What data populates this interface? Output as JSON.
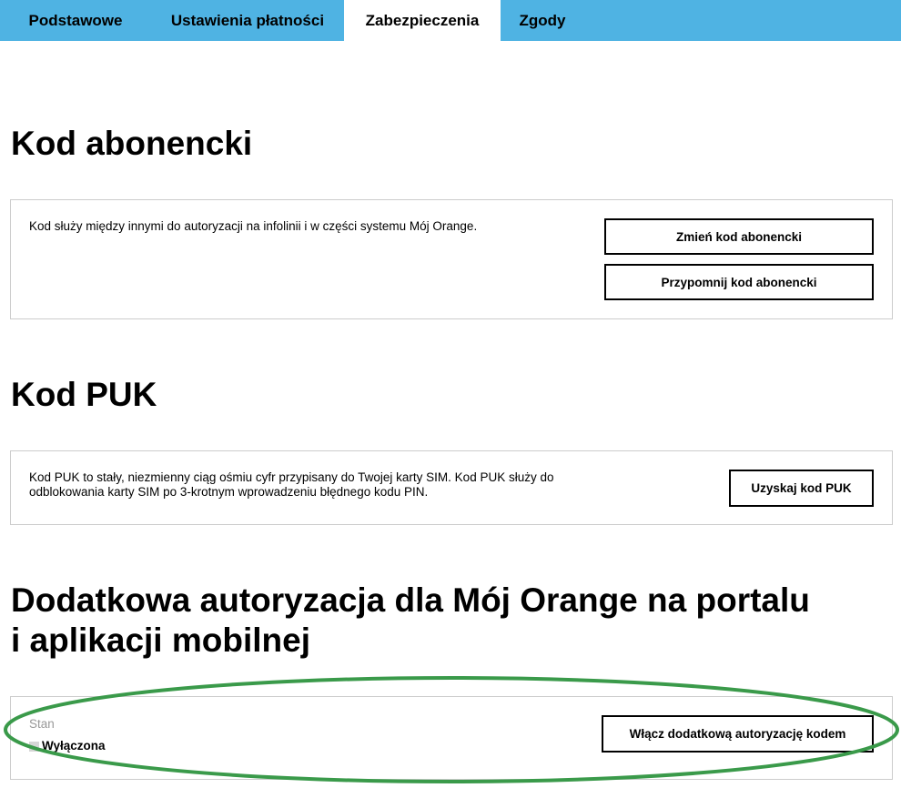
{
  "tabs": [
    {
      "label": "Podstawowe",
      "active": false
    },
    {
      "label": "Ustawienia płatności",
      "active": false
    },
    {
      "label": "Zabezpieczenia",
      "active": true
    },
    {
      "label": "Zgody",
      "active": false
    }
  ],
  "sections": {
    "subscriber_code": {
      "title": "Kod abonencki",
      "description": "Kod służy między innymi do autoryzacji na infolinii i w części systemu Mój Orange.",
      "change_button": "Zmień kod abonencki",
      "remind_button": "Przypomnij kod abonencki"
    },
    "puk": {
      "title": "Kod PUK",
      "description_line1": "Kod PUK to stały, niezmienny ciąg ośmiu cyfr przypisany do Twojej karty SIM. Kod PUK służy do",
      "description_line2": "odblokowania karty SIM po 3-krotnym wprowadzeniu błędnego kodu PIN.",
      "get_button": "Uzyskaj kod PUK"
    },
    "extra_auth": {
      "title_line1": "Dodatkowa autoryzacja dla Mój Orange na portalu",
      "title_line2": "i aplikacji mobilnej",
      "status_label": "Stan",
      "status_value": "Wyłączona",
      "enable_button": "Włącz dodatkową autoryzację kodem"
    }
  },
  "colors": {
    "tabbar": "#4fb3e3",
    "annotation_ellipse": "#3a9a4a"
  }
}
